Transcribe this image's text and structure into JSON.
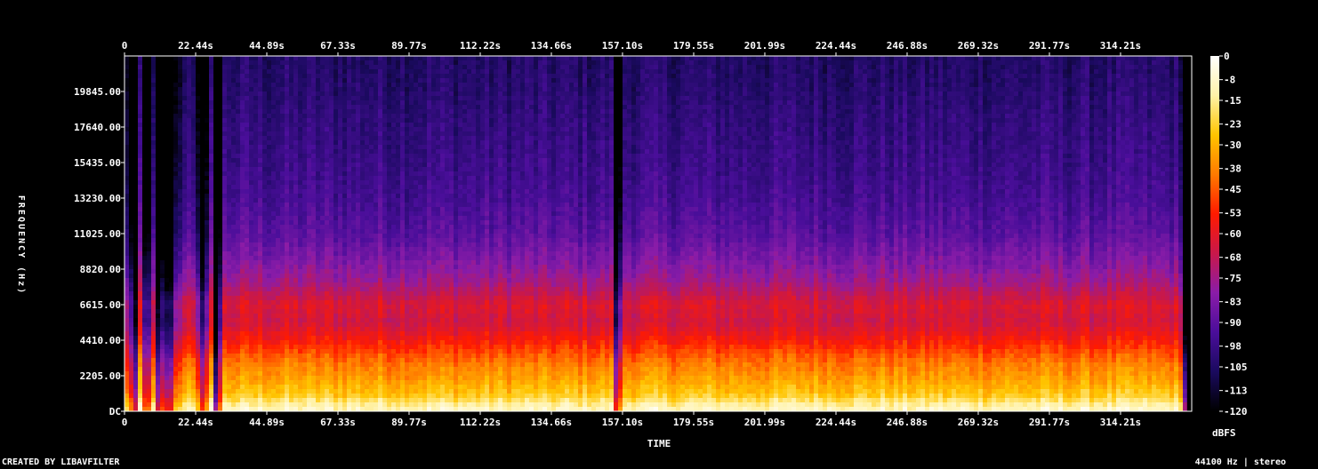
{
  "footer": {
    "credit": "CREATED BY LIBAVFILTER",
    "sample_info": "44100 Hz | stereo"
  },
  "chart_data": {
    "type": "heatmap",
    "title": "",
    "xlabel": "TIME",
    "ylabel": "FREQUENCY (Hz)",
    "colorbar_label": "dBFS",
    "x_unit": "s",
    "xlim": [
      0,
      336.66
    ],
    "ylim": [
      0,
      22050
    ],
    "zlim": [
      -120,
      0
    ],
    "x_ticks": [
      "0",
      "22.44s",
      "44.89s",
      "67.33s",
      "89.77s",
      "112.22s",
      "134.66s",
      "157.10s",
      "179.55s",
      "201.99s",
      "224.44s",
      "246.88s",
      "269.32s",
      "291.77s",
      "314.21s"
    ],
    "x_tick_values": [
      0,
      22.44,
      44.89,
      67.33,
      89.77,
      112.22,
      134.66,
      157.1,
      179.55,
      201.99,
      224.44,
      246.88,
      269.32,
      291.77,
      314.21
    ],
    "y_ticks": [
      "DC",
      "2205.00",
      "4410.00",
      "6615.00",
      "8820.00",
      "11025.00",
      "13230.00",
      "15435.00",
      "17640.00",
      "19845.00"
    ],
    "y_tick_values": [
      0,
      2205,
      4410,
      6615,
      8820,
      11025,
      13230,
      15435,
      17640,
      19845
    ],
    "colorbar_ticks": [
      "0",
      "-8",
      "-15",
      "-23",
      "-30",
      "-38",
      "-45",
      "-53",
      "-60",
      "-68",
      "-75",
      "-83",
      "-90",
      "-98",
      "-105",
      "-113",
      "-120"
    ],
    "colorbar_tick_values": [
      0,
      -8,
      -15,
      -23,
      -30,
      -38,
      -45,
      -53,
      -60,
      -68,
      -75,
      -83,
      -90,
      -98,
      -105,
      -113,
      -120
    ],
    "colormap": [
      "#000000",
      "#1a0a5e",
      "#4a0e9a",
      "#8a1ca8",
      "#c8184a",
      "#ff1a00",
      "#ff7a00",
      "#ffc400",
      "#fff2a8",
      "#ffffff"
    ],
    "freq_profile_hz": [
      0,
      500,
      1000,
      2205,
      3000,
      4410,
      5500,
      6615,
      8000,
      8820,
      11025,
      13230,
      15435,
      17640,
      19845,
      22050
    ],
    "freq_profile_db": [
      -8,
      -15,
      -25,
      -35,
      -40,
      -55,
      -65,
      -62,
      -75,
      -80,
      -90,
      -95,
      -98,
      -100,
      -103,
      -105
    ],
    "quiet_moments_s": [
      3,
      7,
      11,
      14,
      25,
      29,
      155.5,
      334.5
    ]
  }
}
